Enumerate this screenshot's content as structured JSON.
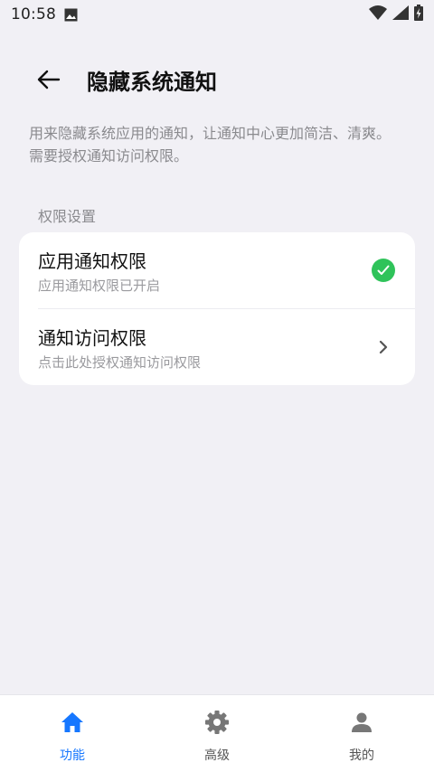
{
  "status_bar": {
    "time": "10:58",
    "icons": [
      "gallery-icon",
      "wifi-icon",
      "signal-icon",
      "battery-charging-icon"
    ]
  },
  "header": {
    "back_icon": "arrow-left-icon",
    "title": "隐藏系统通知"
  },
  "description": "用来隐藏系统应用的通知，让通知中心更加简洁、清爽。需要授权通知访问权限。",
  "section": {
    "label": "权限设置",
    "items": [
      {
        "title": "应用通知权限",
        "subtitle": "应用通知权限已开启",
        "trailing_icon": "check-circle-icon",
        "status_color": "#2fc35a"
      },
      {
        "title": "通知访问权限",
        "subtitle": "点击此处授权通知访问权限",
        "trailing_icon": "chevron-right-icon"
      }
    ]
  },
  "bottom_nav": {
    "items": [
      {
        "label": "功能",
        "icon": "home-icon",
        "active": true
      },
      {
        "label": "高级",
        "icon": "gear-icon",
        "active": false
      },
      {
        "label": "我的",
        "icon": "person-icon",
        "active": false
      }
    ]
  },
  "colors": {
    "accent": "#1677ff",
    "background": "#f1f0f5",
    "success": "#2fc35a"
  }
}
